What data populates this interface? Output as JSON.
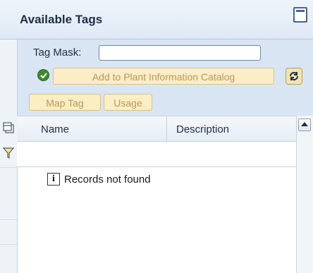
{
  "panel": {
    "title": "Available Tags"
  },
  "toolbar": {
    "tag_mask_label": "Tag Mask:",
    "tag_mask_value": "",
    "add_button_label": "Add to Plant Information Catalog",
    "map_tag_label": "Map Tag",
    "usage_label": "Usage"
  },
  "table": {
    "columns": [
      "Name",
      "Description"
    ],
    "empty_message": "Records not found"
  },
  "icons": {
    "minimize": "minimize-icon",
    "check": "check-icon",
    "refresh": "refresh-icon",
    "column-settings": "column-settings-icon",
    "filter": "filter-icon",
    "info": "info-icon",
    "scroll-up": "scroll-up-arrow-icon"
  },
  "colors": {
    "header_bg": "#dfe9f5",
    "toolbar_bg": "#d9e5f2",
    "button_bg": "#fbedc4",
    "button_text_disabled": "#b79a5b",
    "check_green": "#3c8a2d"
  }
}
